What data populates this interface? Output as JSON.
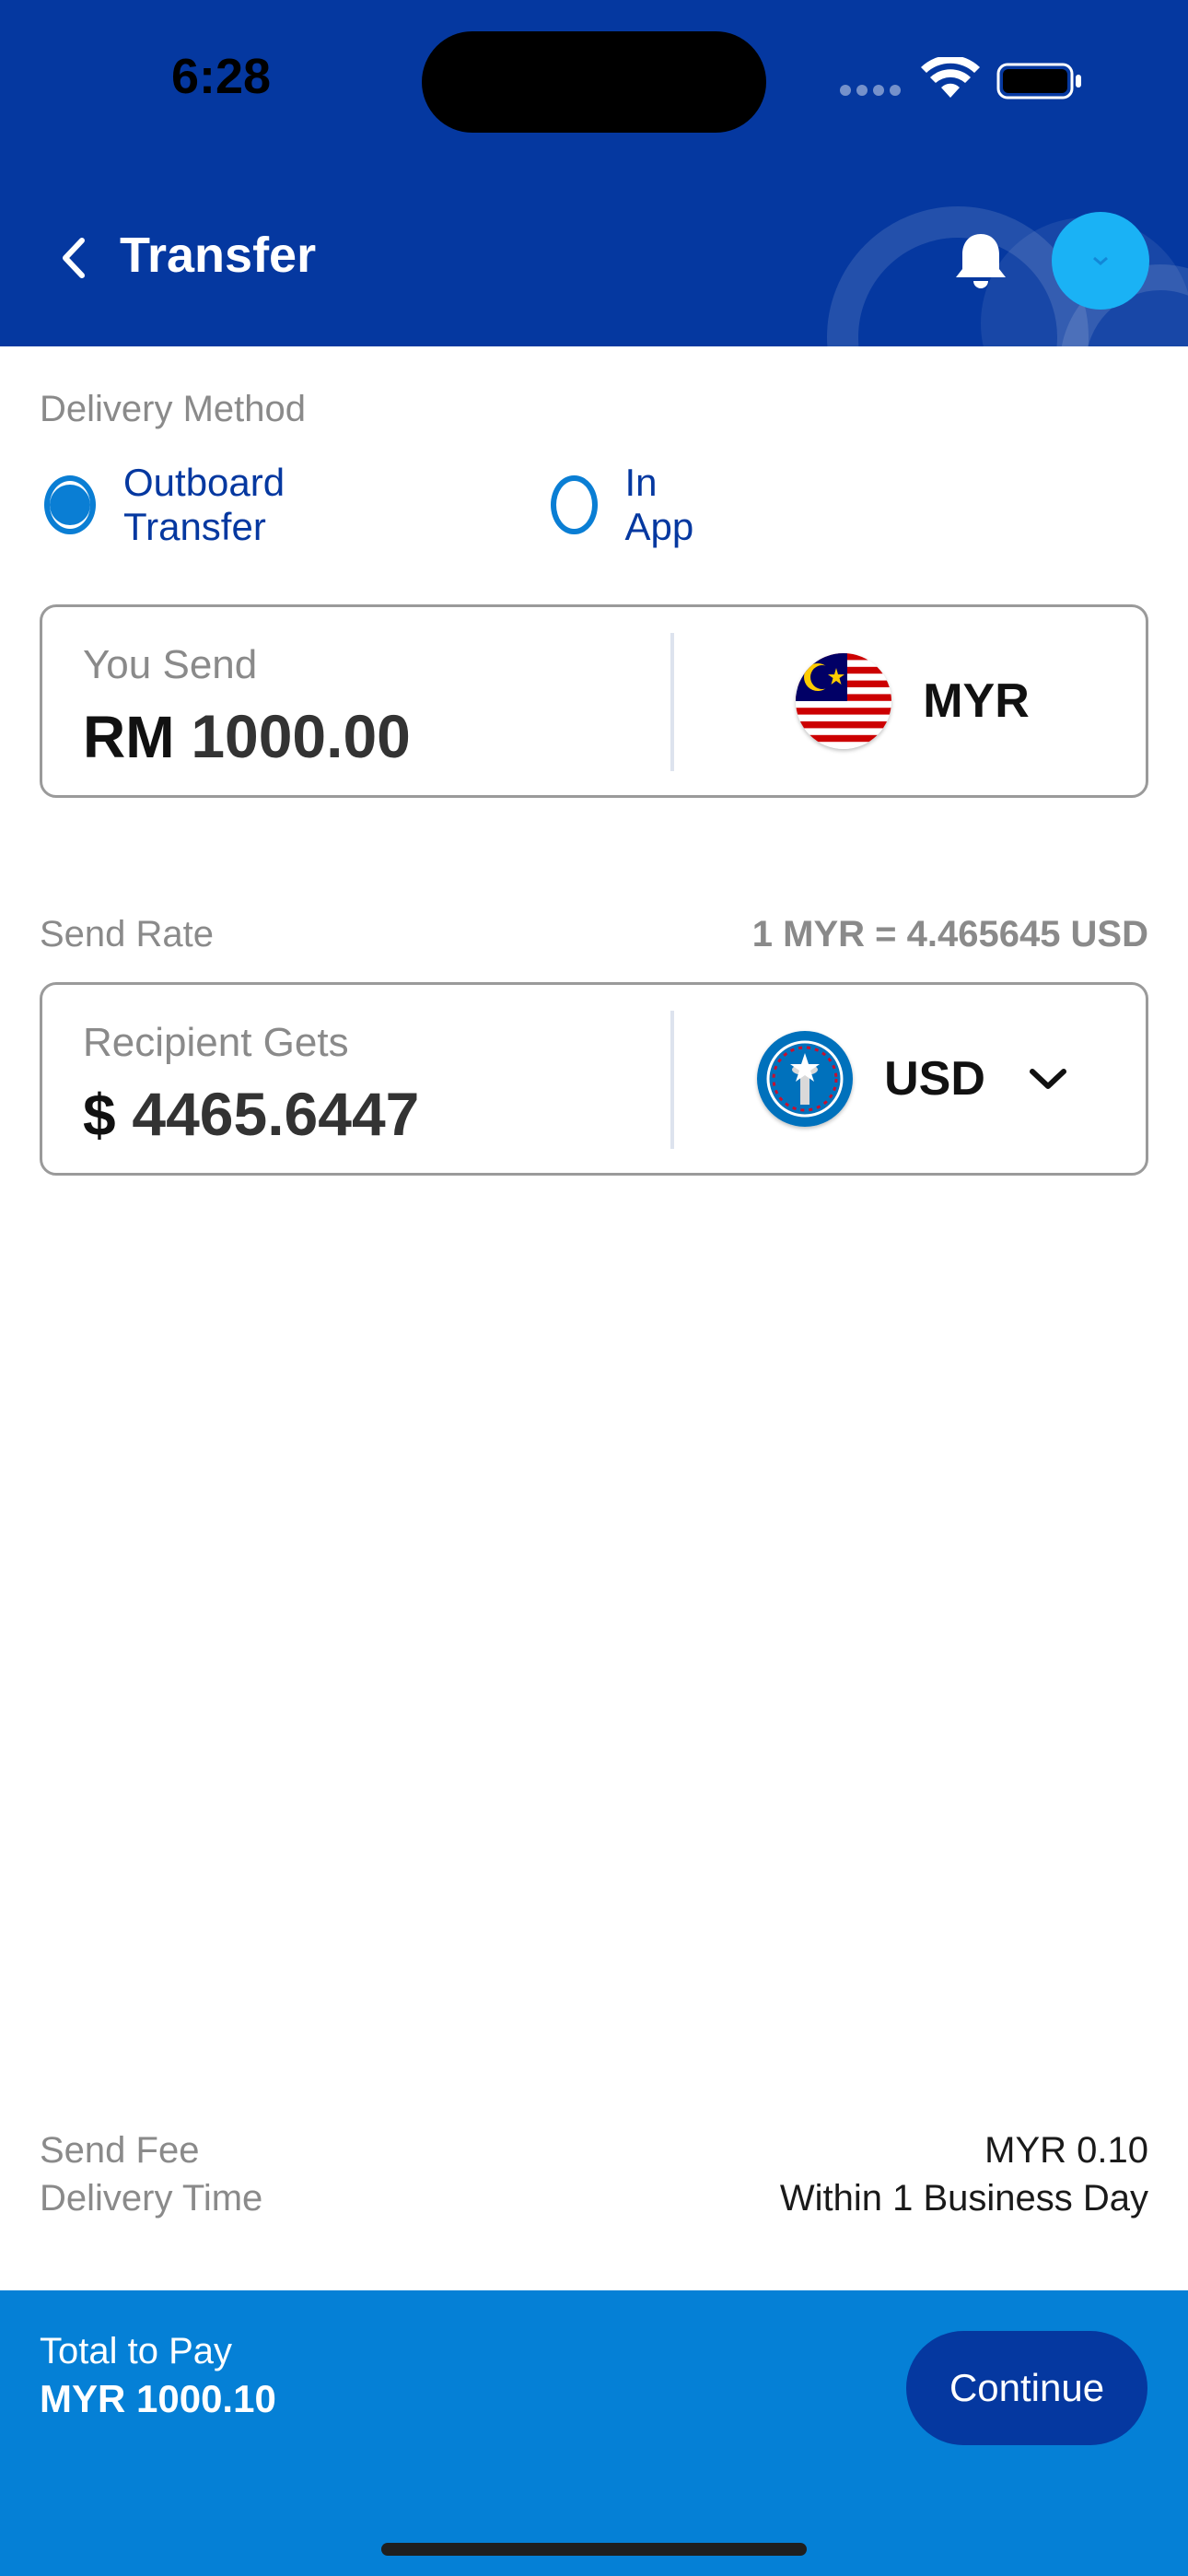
{
  "status_bar": {
    "time": "6:28"
  },
  "header": {
    "title": "Transfer"
  },
  "delivery": {
    "label": "Delivery Method",
    "options": [
      {
        "label": "Outboard Transfer",
        "selected": true
      },
      {
        "label": "In App",
        "selected": false
      }
    ]
  },
  "send": {
    "label": "You Send",
    "symbol": "RM",
    "amount": "1000.00",
    "currency": "MYR",
    "flag_icon": "malaysia-flag-icon"
  },
  "rate": {
    "label": "Send Rate",
    "value": "1 MYR = 4.465645 USD"
  },
  "receive": {
    "label": "Recipient Gets",
    "symbol": "$",
    "amount": "4465.6447",
    "currency": "USD",
    "flag_icon": "northern-mariana-islands-flag-icon"
  },
  "fees": {
    "send_fee_label": "Send Fee",
    "send_fee_value": "MYR 0.10",
    "delivery_time_label": "Delivery Time",
    "delivery_time_value": "Within 1 Business Day"
  },
  "footer": {
    "total_label": "Total to Pay",
    "total_value": "MYR 1000.10",
    "continue_label": "Continue"
  },
  "colors": {
    "primary": "#0538a0",
    "accent": "#0580d6",
    "radio": "#0a7ed4",
    "avatar": "#1ab2f5"
  }
}
